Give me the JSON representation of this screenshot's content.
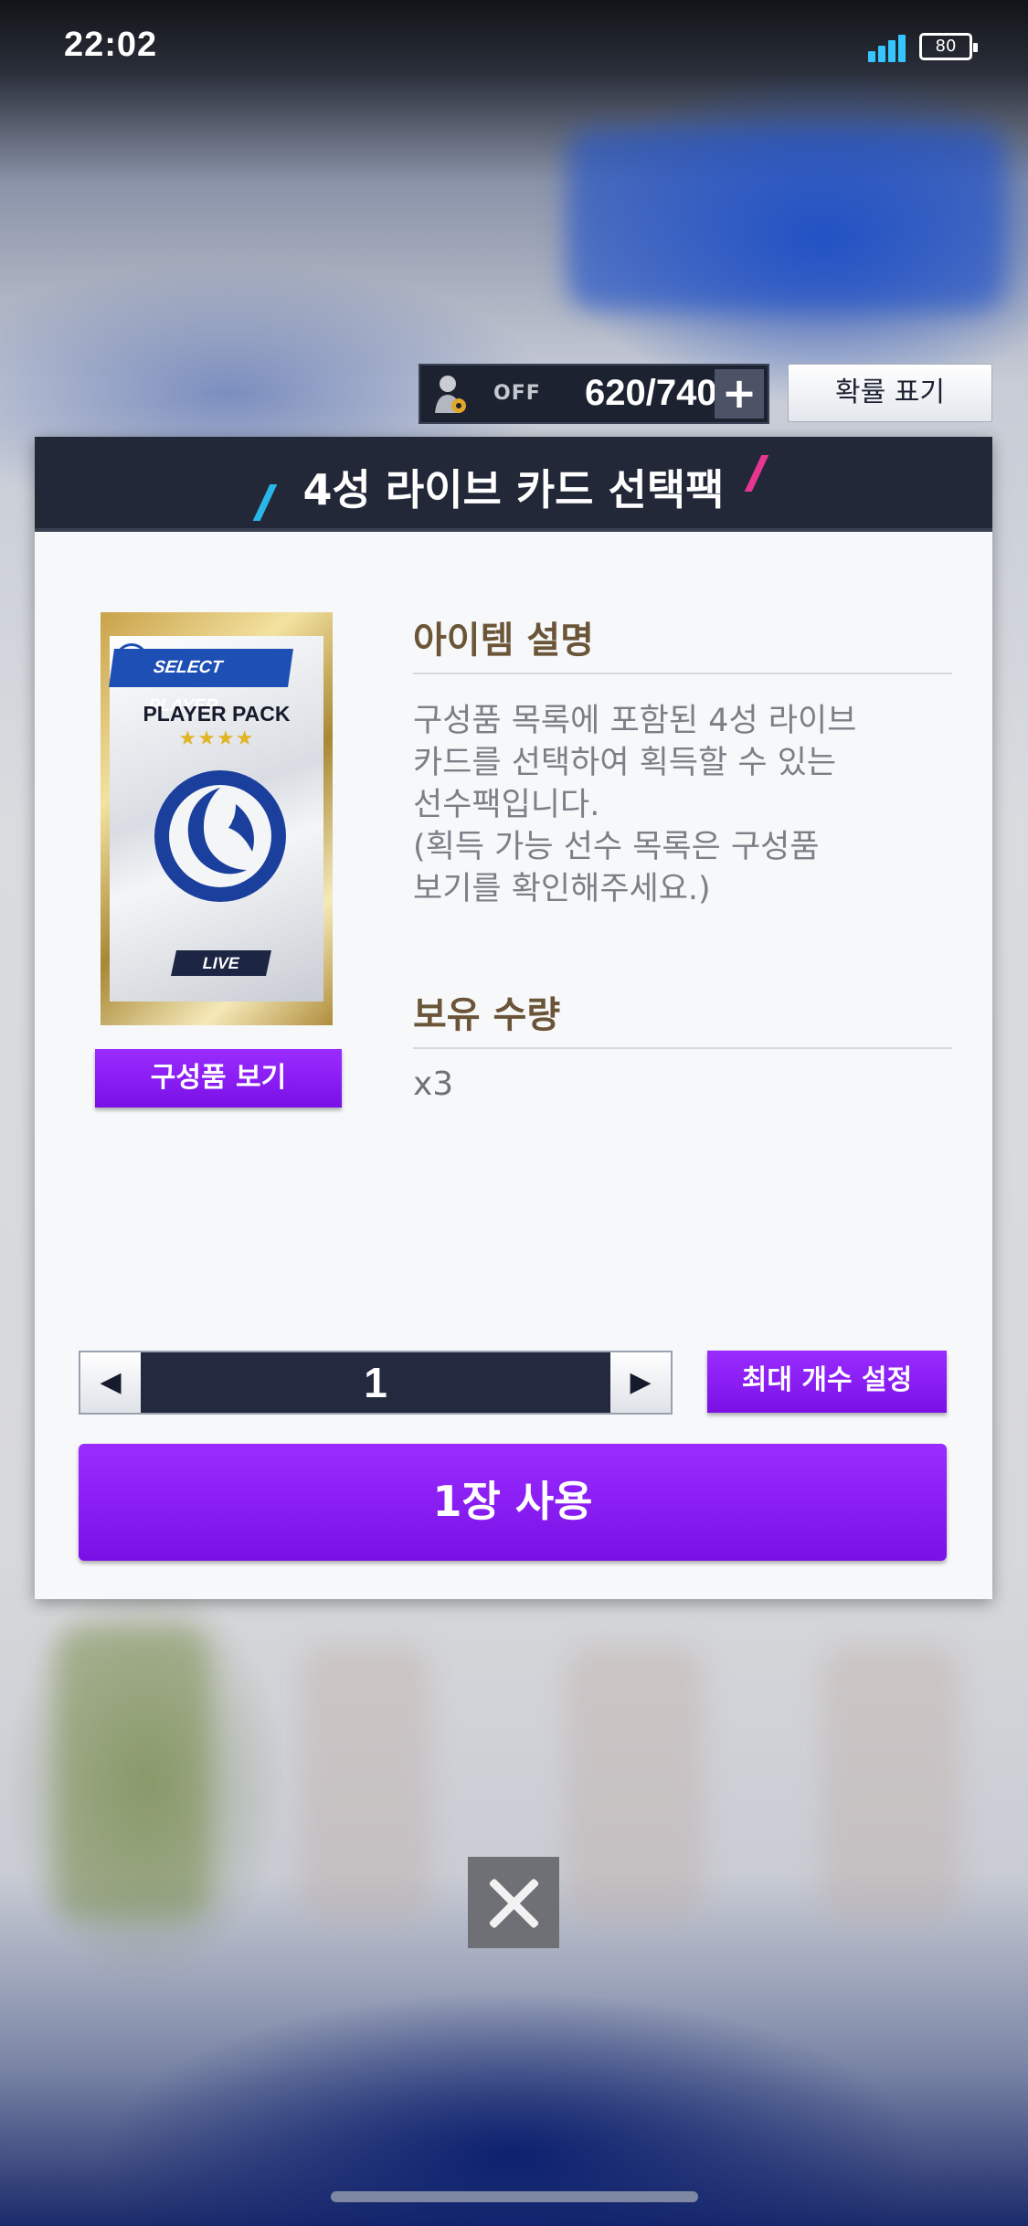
{
  "status_bar": {
    "time": "22:02",
    "battery_level": "80",
    "icons": [
      "signal-icon",
      "battery-icon"
    ]
  },
  "top_bar": {
    "auto_toggle_label": "OFF",
    "counter_value": "620/740",
    "plus_label": "+",
    "probability_button": "확률 표기"
  },
  "dialog": {
    "title": "4성 라이브 카드 선택팩",
    "pack_card": {
      "badge": "SELECT PLAYER",
      "label": "PLAYER PACK",
      "stars": "★★★★",
      "tag": "LIVE"
    },
    "components_button": "구성품 보기",
    "description_title": "아이템 설명",
    "description_lines": [
      "구성품 목록에 포함된 4성 라이브",
      "카드를 선택하여 획득할 수 있는",
      "선수팩입니다.",
      "(획득 가능 선수 목록은 구성품",
      "보기를 확인해주세요.)"
    ],
    "owned_title": "보유 수량",
    "owned_value": "x3",
    "quantity": {
      "value": "1",
      "decrement_icon": "◀",
      "increment_icon": "▶"
    },
    "max_button": "최대 개수 설정",
    "use_button": "1장 사용"
  },
  "colors": {
    "accent_purple": "#8a1cf5",
    "header_navy": "#222838",
    "section_title_brown": "#6b5538",
    "slash_blue": "#29b7ea",
    "slash_pink": "#e8358f"
  }
}
